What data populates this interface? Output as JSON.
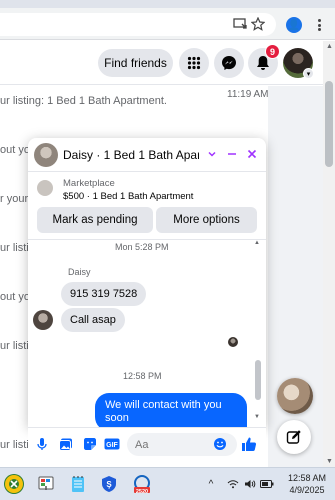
{
  "browser": {
    "profile_initial": "👤"
  },
  "header": {
    "find_friends_label": "Find friends",
    "notification_count": "9"
  },
  "background": {
    "lines": [
      "ur listing: 1 Bed 1 Bath Apartment.",
      "out yo",
      "r your",
      "ur listin",
      "out yo",
      "ur listin",
      "ur listin"
    ],
    "time": "11:19 AM"
  },
  "chat": {
    "title": "Daisy · 1 Bed 1 Bath Apart...",
    "listing_source": "Marketplace",
    "listing_info": "$500 · 1 Bed 1 Bath Apartment",
    "mark_pending_label": "Mark as pending",
    "more_options_label": "More options",
    "timestamp_1": "Mon 5:28 PM",
    "sender_name": "Daisy",
    "incoming": [
      "915 319 7528",
      "Call asap"
    ],
    "timestamp_2": "12:58 PM",
    "outgoing": "We will contact with you soon"
  },
  "composer": {
    "placeholder": "Aa"
  },
  "taskbar": {
    "time": "12:58 AM",
    "date": "4/9/2025",
    "badge_text": "2520"
  },
  "colors": {
    "accent_blue": "#0866ff",
    "messenger_purple": "#a033ff",
    "notification_red": "#e41e3f"
  }
}
